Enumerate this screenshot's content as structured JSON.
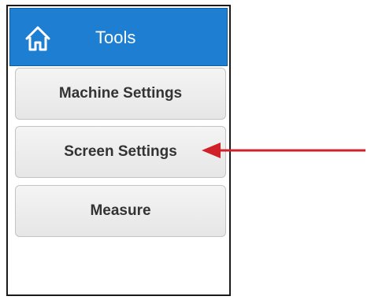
{
  "header": {
    "title": "Tools",
    "icon": "home-icon",
    "color": "#1e7fd2"
  },
  "menu": {
    "items": [
      {
        "label": "Machine Settings"
      },
      {
        "label": "Screen Settings"
      },
      {
        "label": "Measure"
      }
    ]
  },
  "annotation": {
    "arrow_color": "#d0202a",
    "points_to": "Screen Settings"
  }
}
